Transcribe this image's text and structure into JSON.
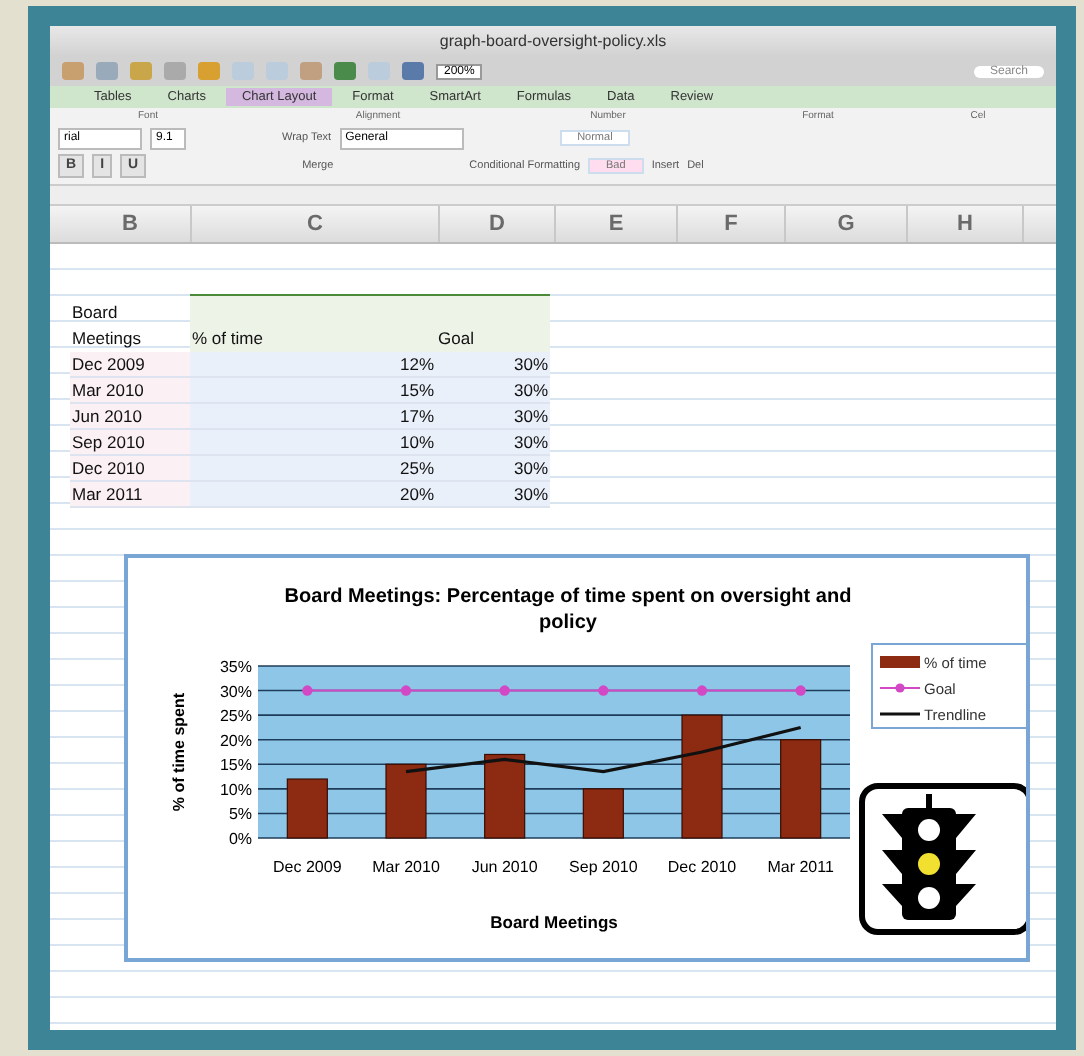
{
  "window": {
    "title": "graph-board-oversight-policy.xls"
  },
  "toolbar": {
    "zoom": "200%",
    "search": "Search"
  },
  "tabs": [
    {
      "label": "Tables",
      "selected": false
    },
    {
      "label": "Charts",
      "selected": false
    },
    {
      "label": "Chart Layout",
      "selected": true
    },
    {
      "label": "Format",
      "selected": false
    },
    {
      "label": "SmartArt",
      "selected": false
    },
    {
      "label": "Formulas",
      "selected": false
    },
    {
      "label": "Data",
      "selected": false
    },
    {
      "label": "Review",
      "selected": false
    }
  ],
  "ribbon": {
    "groups": [
      "Font",
      "Alignment",
      "Number",
      "Format",
      "Cel"
    ],
    "font": "rial",
    "font_size": "9.1",
    "bold": "B",
    "italic": "I",
    "underline": "U",
    "wrap_text": "Wrap Text",
    "number_format": "General",
    "merge": "Merge",
    "conditional": "Conditional Formatting",
    "styles": [
      "Normal",
      "Bad"
    ],
    "cells": [
      "Insert",
      "Del"
    ]
  },
  "columns": [
    "B",
    "C",
    "D",
    "E",
    "F",
    "G",
    "H"
  ],
  "table": {
    "header": [
      "Board Meetings",
      "% of time",
      "Goal"
    ],
    "rows": [
      [
        "Dec 2009",
        "12%",
        "30%"
      ],
      [
        "Mar 2010",
        "15%",
        "30%"
      ],
      [
        "Jun 2010",
        "17%",
        "30%"
      ],
      [
        "Sep 2010",
        "10%",
        "30%"
      ],
      [
        "Dec 2010",
        "25%",
        "30%"
      ],
      [
        "Mar 2011",
        "20%",
        "30%"
      ]
    ]
  },
  "chart": {
    "chart_data": {
      "type": "bar",
      "title": "Board Meetings: Percentage of time spent on oversight and policy",
      "xlabel": "Board Meetings",
      "ylabel": "% of time spent",
      "categories": [
        "Dec 2009",
        "Mar 2010",
        "Jun 2010",
        "Sep 2010",
        "Dec 2010",
        "Mar 2011"
      ],
      "series": [
        {
          "name": "% of time",
          "type": "bar",
          "color": "#8c2a12",
          "values": [
            12,
            15,
            17,
            10,
            25,
            20
          ]
        },
        {
          "name": "Goal",
          "type": "line",
          "marker": "circle",
          "color": "#d348c4",
          "values": [
            30,
            30,
            30,
            30,
            30,
            30
          ]
        },
        {
          "name": "Trendline",
          "type": "line",
          "color": "#111111",
          "values": [
            null,
            13.5,
            16,
            13.5,
            17.5,
            22.5
          ]
        }
      ],
      "ylim": [
        0,
        35
      ],
      "grid": true,
      "legend": "right",
      "yticks": [
        {
          "value": 0,
          "label": "0%"
        },
        {
          "value": 5,
          "label": "5%"
        },
        {
          "value": 10,
          "label": "10%"
        },
        {
          "value": 15,
          "label": "15%"
        },
        {
          "value": 20,
          "label": "20%"
        },
        {
          "value": 25,
          "label": "25%"
        },
        {
          "value": 30,
          "label": "30%"
        },
        {
          "value": 35,
          "label": "35%"
        }
      ]
    }
  }
}
